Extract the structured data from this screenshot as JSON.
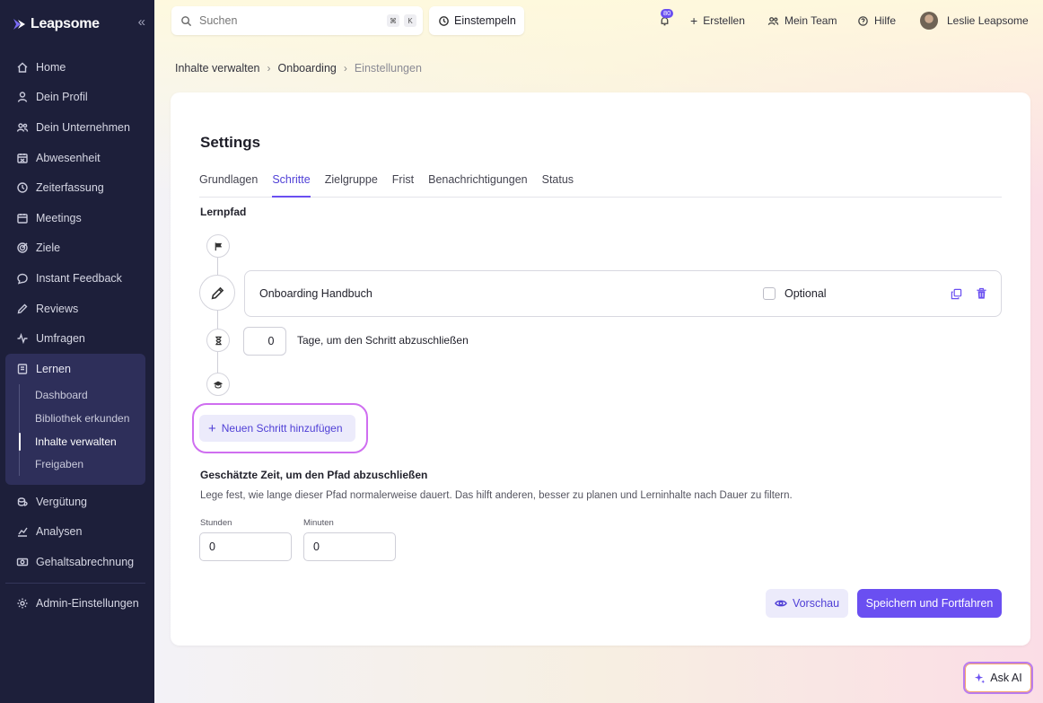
{
  "brand": {
    "name": "Leapsome",
    "accent": "#6a4ff1",
    "sidebar_bg": "#1d1f3a"
  },
  "sidebar": {
    "items": [
      {
        "label": "Home",
        "icon": "home-icon"
      },
      {
        "label": "Dein Profil",
        "icon": "user-icon"
      },
      {
        "label": "Dein Unternehmen",
        "icon": "team-icon"
      },
      {
        "label": "Abwesenheit",
        "icon": "calendar-x-icon"
      },
      {
        "label": "Zeiterfassung",
        "icon": "clock-icon"
      },
      {
        "label": "Meetings",
        "icon": "calendar-icon"
      },
      {
        "label": "Ziele",
        "icon": "target-icon"
      },
      {
        "label": "Instant Feedback",
        "icon": "chat-icon"
      },
      {
        "label": "Reviews",
        "icon": "pen-icon"
      },
      {
        "label": "Umfragen",
        "icon": "pulse-icon"
      }
    ],
    "learn": {
      "label": "Lernen",
      "icon": "book-icon",
      "subitems": [
        {
          "label": "Dashboard"
        },
        {
          "label": "Bibliothek erkunden"
        },
        {
          "label": "Inhalte verwalten"
        },
        {
          "label": "Freigaben"
        }
      ],
      "active_subitem": "Inhalte verwalten"
    },
    "items_after": [
      {
        "label": "Vergütung",
        "icon": "coins-icon"
      },
      {
        "label": "Analysen",
        "icon": "chart-icon"
      },
      {
        "label": "Gehaltsabrechnung",
        "icon": "money-icon"
      }
    ],
    "admin": {
      "label": "Admin-Einstellungen",
      "icon": "gear-icon"
    }
  },
  "topbar": {
    "search_placeholder": "Suchen",
    "shortcut_keys": [
      "⌘",
      "K"
    ],
    "clock_in_label": "Einstempeln",
    "notification_count": "80",
    "create_label": "Erstellen",
    "team_label": "Mein Team",
    "help_label": "Hilfe",
    "user_name": "Leslie Leapsome"
  },
  "breadcrumb": [
    "Inhalte verwalten",
    "Onboarding",
    "Einstellungen"
  ],
  "page": {
    "title": "Settings",
    "tabs": [
      "Grundlagen",
      "Schritte",
      "Zielgruppe",
      "Frist",
      "Benachrichtigungen",
      "Status"
    ],
    "active_tab": "Schritte",
    "section_label": "Lernpfad",
    "step": {
      "name": "Onboarding Handbuch",
      "optional_label": "Optional",
      "optional_checked": false
    },
    "days": {
      "value": "0",
      "label": "Tage, um den Schritt abzuschließen"
    },
    "add_step_label": "Neuen Schritt hinzufügen",
    "estimate": {
      "title": "Geschätzte Zeit, um den Pfad abzuschließen",
      "description": "Lege fest, wie lange dieser Pfad normalerweise dauert. Das hilft anderen, besser zu planen und Lerninhalte nach Dauer zu filtern.",
      "hours_label": "Stunden",
      "hours_value": "0",
      "minutes_label": "Minuten",
      "minutes_value": "0"
    },
    "preview_label": "Vorschau",
    "save_label": "Speichern und Fortfahren"
  },
  "ask_ai_label": "Ask AI"
}
